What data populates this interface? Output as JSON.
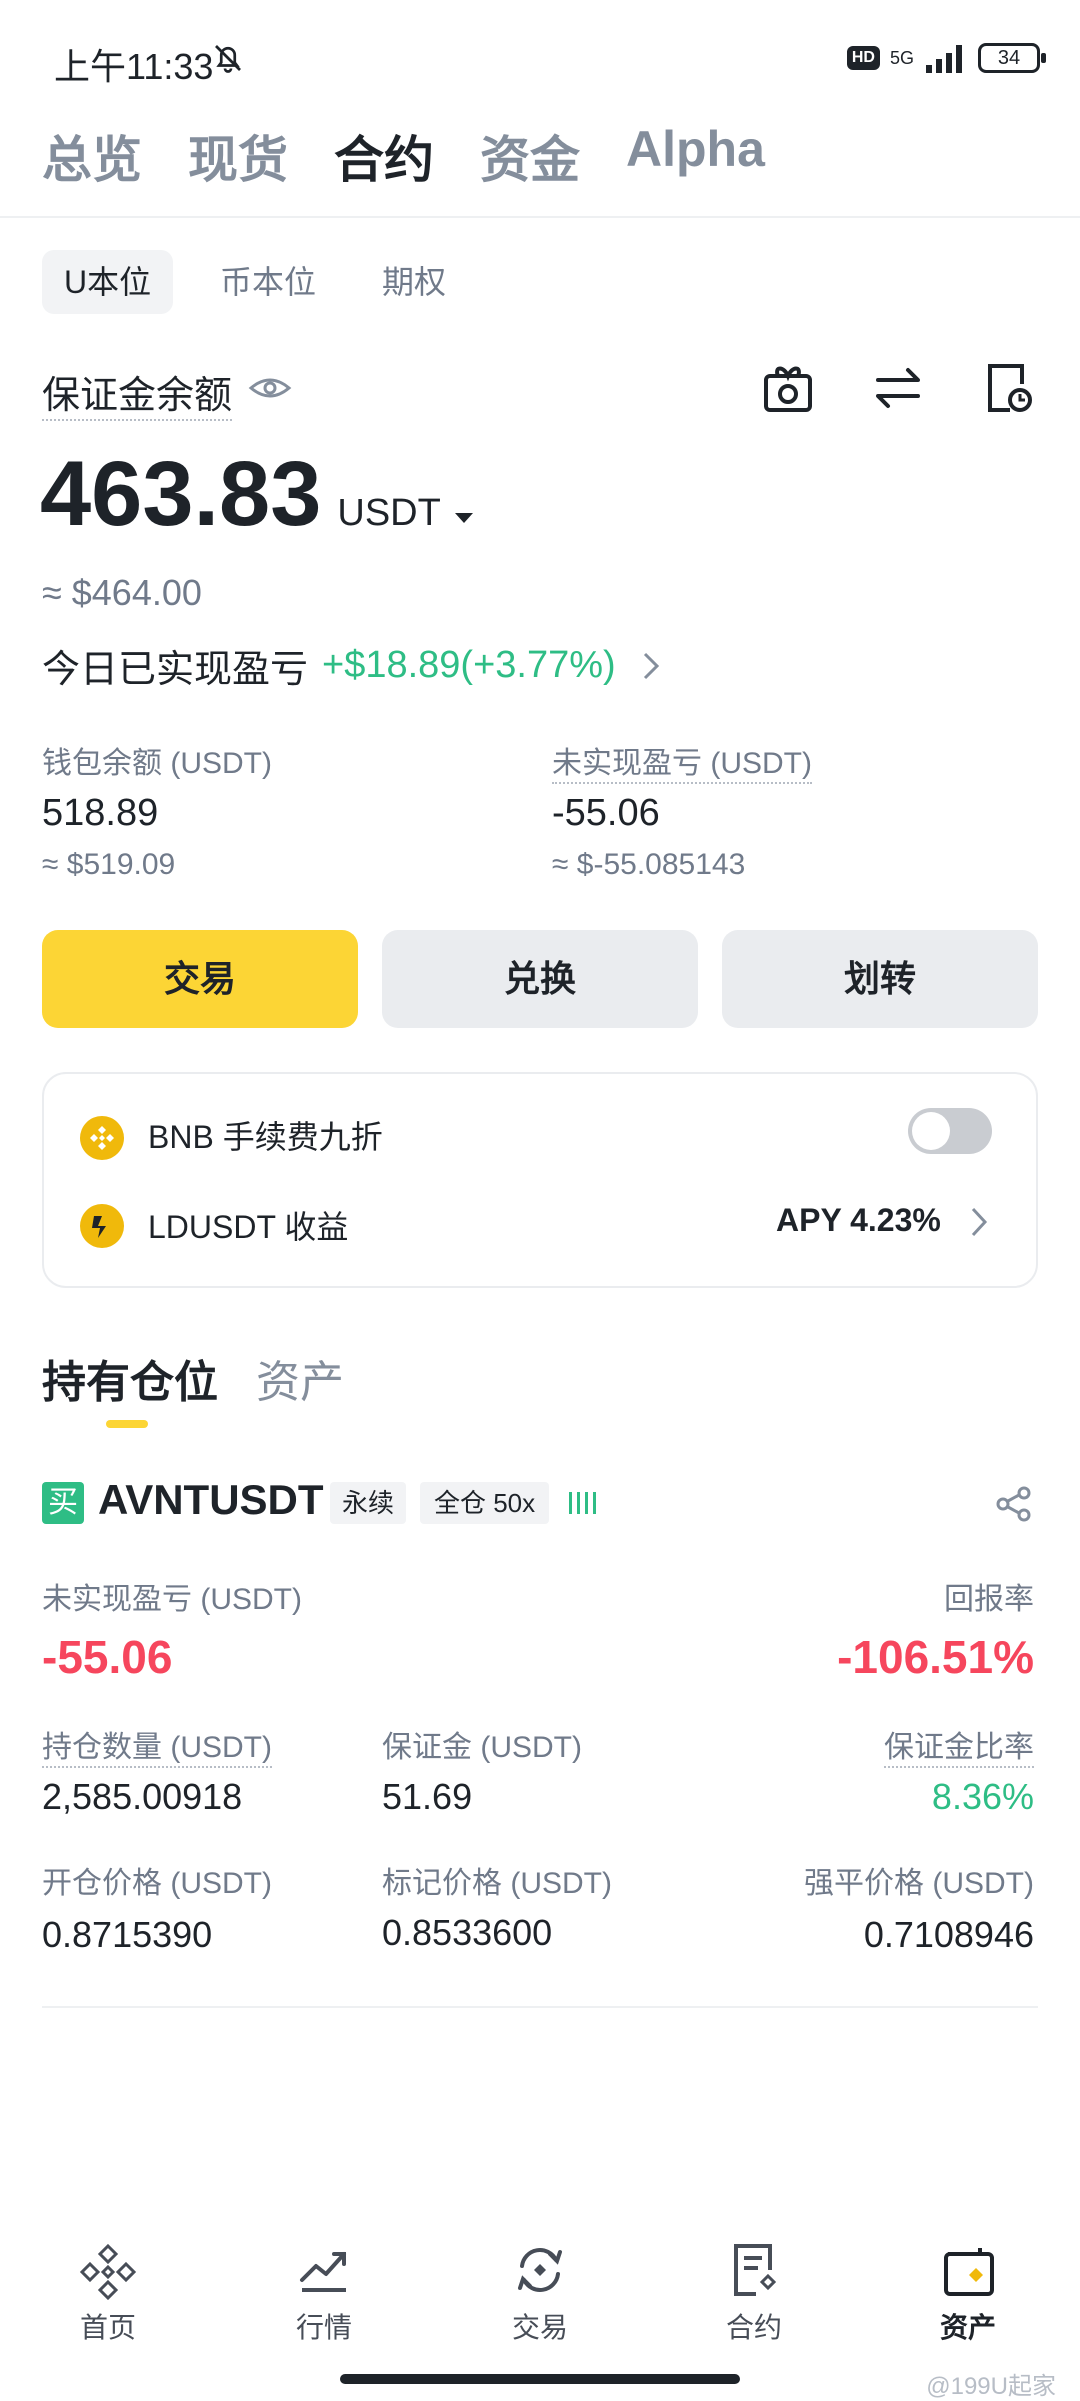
{
  "status_bar": {
    "time": "上午11:33",
    "hd": "HD",
    "network": "5G",
    "battery": "34"
  },
  "top_tabs": [
    "总览",
    "现货",
    "合约",
    "资金",
    "Alpha"
  ],
  "active_top_tab": "合约",
  "sub_tabs": [
    "U本位",
    "币本位",
    "期权"
  ],
  "margin": {
    "label": "保证金余额",
    "value": "463.83",
    "unit": "USDT",
    "approx": "≈ $464.00",
    "pnl_label": "今日已实现盈亏",
    "pnl_value": "+$18.89(+3.77%)"
  },
  "wallet": {
    "label": "钱包余额 (USDT)",
    "value": "518.89",
    "approx": "≈ $519.09"
  },
  "unrealized": {
    "label": "未实现盈亏 (USDT)",
    "value": "-55.06",
    "approx": "≈ $-55.085143"
  },
  "buttons": {
    "trade": "交易",
    "convert": "兑换",
    "transfer": "划转"
  },
  "bnb_row": {
    "label": "BNB 手续费九折",
    "toggle_on": false
  },
  "ld_row": {
    "label": "LDUSDT 收益",
    "apy": "APY 4.23%"
  },
  "section_tabs": [
    "持有仓位",
    "资产"
  ],
  "position": {
    "side": "买",
    "symbol": "AVNTUSDT",
    "tag1": "永续",
    "tag2": "全仓 50x",
    "pnl_label": "未实现盈亏 (USDT)",
    "pnl_value": "-55.06",
    "roe_label": "回报率",
    "roe_value": "-106.51%",
    "size_label": "持仓数量 (USDT)",
    "size_value": "2,585.00918",
    "margin_label": "保证金 (USDT)",
    "margin_value": "51.69",
    "margin_ratio_label": "保证金比率",
    "margin_ratio_value": "8.36%",
    "entry_label": "开仓价格 (USDT)",
    "entry_value": "0.8715390",
    "mark_label": "标记价格 (USDT)",
    "mark_value": "0.8533600",
    "liq_label": "强平价格 (USDT)",
    "liq_value": "0.7108946"
  },
  "bottom_nav": [
    "首页",
    "行情",
    "交易",
    "合约",
    "资产"
  ],
  "watermark": "@199U起家",
  "colors": {
    "accent": "#fcd535",
    "green": "#2ebd85",
    "red": "#f6465d",
    "buy": "#2ebd85"
  }
}
